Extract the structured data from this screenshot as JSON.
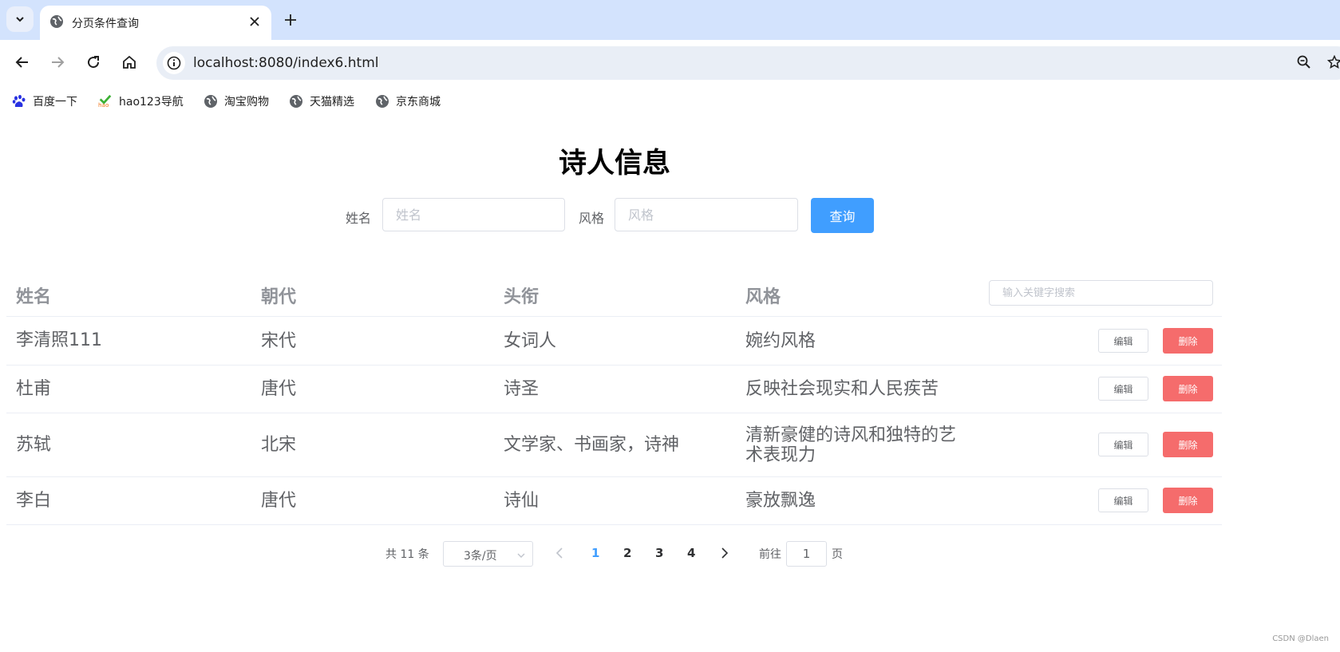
{
  "browser": {
    "tab_title": "分页条件查询",
    "url": "localhost:8080/index6.html",
    "bookmarks": [
      {
        "label": "百度一下",
        "icon": "baidu-paw-icon"
      },
      {
        "label": "hao123导航",
        "icon": "hao123-icon"
      },
      {
        "label": "淘宝购物",
        "icon": "globe-icon"
      },
      {
        "label": "天猫精选",
        "icon": "globe-icon"
      },
      {
        "label": "京东商城",
        "icon": "globe-icon"
      }
    ]
  },
  "page": {
    "title": "诗人信息",
    "form": {
      "name_label": "姓名",
      "name_placeholder": "姓名",
      "style_label": "风格",
      "style_placeholder": "风格",
      "query_button": "查询"
    },
    "table": {
      "headers": [
        "姓名",
        "朝代",
        "头衔",
        "风格"
      ],
      "search_placeholder": "输入关键字搜索",
      "edit_label": "编辑",
      "delete_label": "删除",
      "rows": [
        {
          "name": "李清照111",
          "dynasty": "宋代",
          "title": "女词人",
          "style": "婉约风格"
        },
        {
          "name": "杜甫",
          "dynasty": "唐代",
          "title": "诗圣",
          "style": "反映社会现实和人民疾苦"
        },
        {
          "name": "苏轼",
          "dynasty": "北宋",
          "title": "文学家、书画家，诗神",
          "style_line1": "清新豪健的诗风和独特的艺",
          "style_line2": "术表现力"
        },
        {
          "name": "李白",
          "dynasty": "唐代",
          "title": "诗仙",
          "style": "豪放飘逸"
        }
      ]
    },
    "pagination": {
      "total_text": "共 11 条",
      "page_size": "3条/页",
      "pages": [
        "1",
        "2",
        "3",
        "4"
      ],
      "current_page": "1",
      "goto_prefix": "前往",
      "goto_value": "1",
      "goto_suffix": "页"
    },
    "watermark": "CSDN @Dlaen"
  },
  "colors": {
    "primary": "#409eff",
    "danger": "#f56c6c",
    "tabbar": "#d3e3fd"
  }
}
